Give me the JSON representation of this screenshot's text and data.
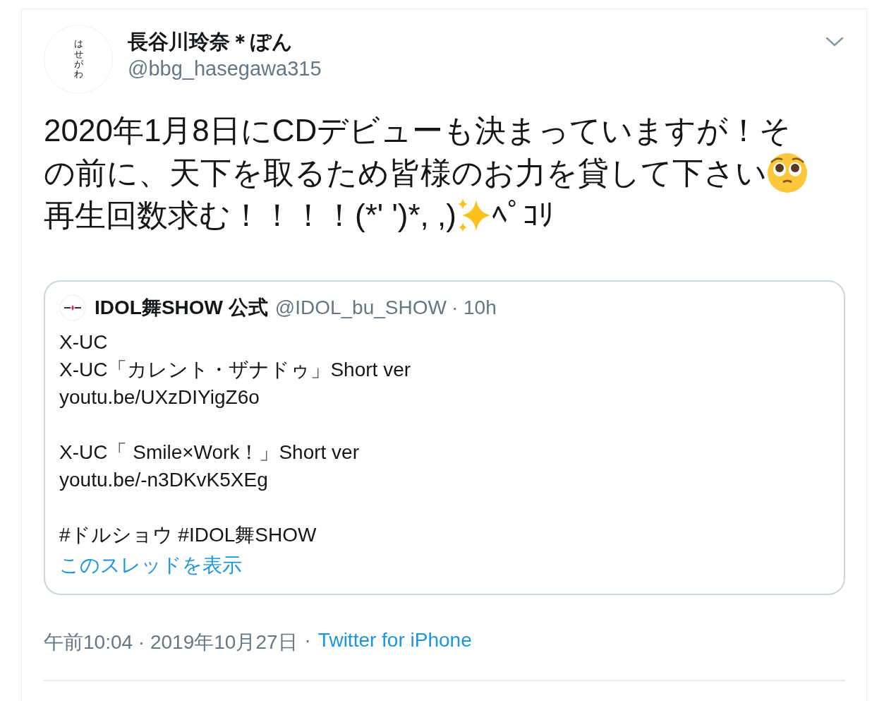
{
  "author": {
    "avatar_text": "はせがわ",
    "name": "長谷川玲奈＊ぽん",
    "handle": "@bbg_hasegawa315"
  },
  "body": [
    [
      {
        "kind": "text",
        "text": "2020年1月8日にCDデビューも決まっていますが！そ"
      }
    ],
    [
      {
        "kind": "text",
        "text": "の前に、天下を取るため皆様のお力を貸して下さい"
      },
      {
        "kind": "face"
      }
    ],
    [
      {
        "kind": "text",
        "text": "再生回数求む！！！！(*' ')*, ,)"
      },
      {
        "kind": "sparkles"
      },
      {
        "kind": "text",
        "text": "ﾍﾟｺﾘ"
      }
    ]
  ],
  "quote": {
    "name": "IDOL舞SHOW 公式",
    "handle": "@IDOL_bu_SHOW",
    "time": "· 10h",
    "paragraphs": [
      [
        "X-UC",
        "X-UC「カレント・ザナドゥ」Short ver",
        "youtu.be/UXzDIYigZ6o"
      ],
      [
        "X-UC「 Smile×Work！」Short ver",
        "youtu.be/-n3DKvK5XEg"
      ],
      [
        "#ドルショウ #IDOL舞SHOW"
      ]
    ],
    "thread_link": "このスレッドを表示"
  },
  "meta": {
    "time": "午前10:04 · 2019年10月27日",
    "separator": "·",
    "source": "Twitter for iPhone"
  }
}
